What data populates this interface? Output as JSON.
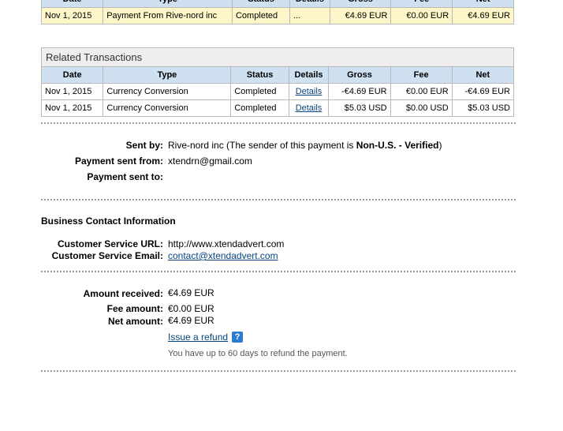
{
  "top_table": {
    "headers": [
      "Date",
      "Type",
      "Status",
      "Details",
      "Gross",
      "Fee",
      "Net"
    ],
    "row": {
      "date": "Nov 1, 2015",
      "type": "Payment From Rive-nord inc",
      "status": "Completed",
      "details": "...",
      "gross": "€4.69 EUR",
      "fee": "€0.00 EUR",
      "net": "€4.69 EUR"
    }
  },
  "related": {
    "title": "Related Transactions",
    "headers": [
      "Date",
      "Type",
      "Status",
      "Details",
      "Gross",
      "Fee",
      "Net"
    ],
    "rows": [
      {
        "date": "Nov 1, 2015",
        "type": "Currency Conversion",
        "status": "Completed",
        "details": "Details",
        "gross": "-€4.69 EUR",
        "fee": "€0.00 EUR",
        "net": "-€4.69 EUR"
      },
      {
        "date": "Nov 1, 2015",
        "type": "Currency Conversion",
        "status": "Completed",
        "details": "Details",
        "gross": "$5.03 USD",
        "fee": "$0.00 USD",
        "net": "$5.03 USD"
      }
    ]
  },
  "sender": {
    "sent_by_label": "Sent by:",
    "sent_by_value_prefix": "Rive-nord inc (The sender of this payment is ",
    "sent_by_value_bold": "Non-U.S. - Verified",
    "sent_by_value_suffix": ")",
    "sent_from_label": "Payment sent from:",
    "sent_from_value": "xtendrn@gmail.com",
    "sent_to_label": "Payment sent to:"
  },
  "business": {
    "title": "Business Contact Information",
    "url_label": "Customer Service URL:",
    "url_value": "http://www.xtendadvert.com",
    "email_label": "Customer Service Email:",
    "email_value": "contact@xtendadvert.com"
  },
  "amounts": {
    "received_label": "Amount received:",
    "received_value": "€4.69 EUR",
    "fee_label": "Fee amount:",
    "fee_value": "€0.00 EUR",
    "net_label": "Net amount:",
    "net_value": "€4.69 EUR",
    "refund_link": "Issue a refund",
    "help_icon": "?",
    "refund_note": "You have up to 60 days to refund the payment."
  }
}
